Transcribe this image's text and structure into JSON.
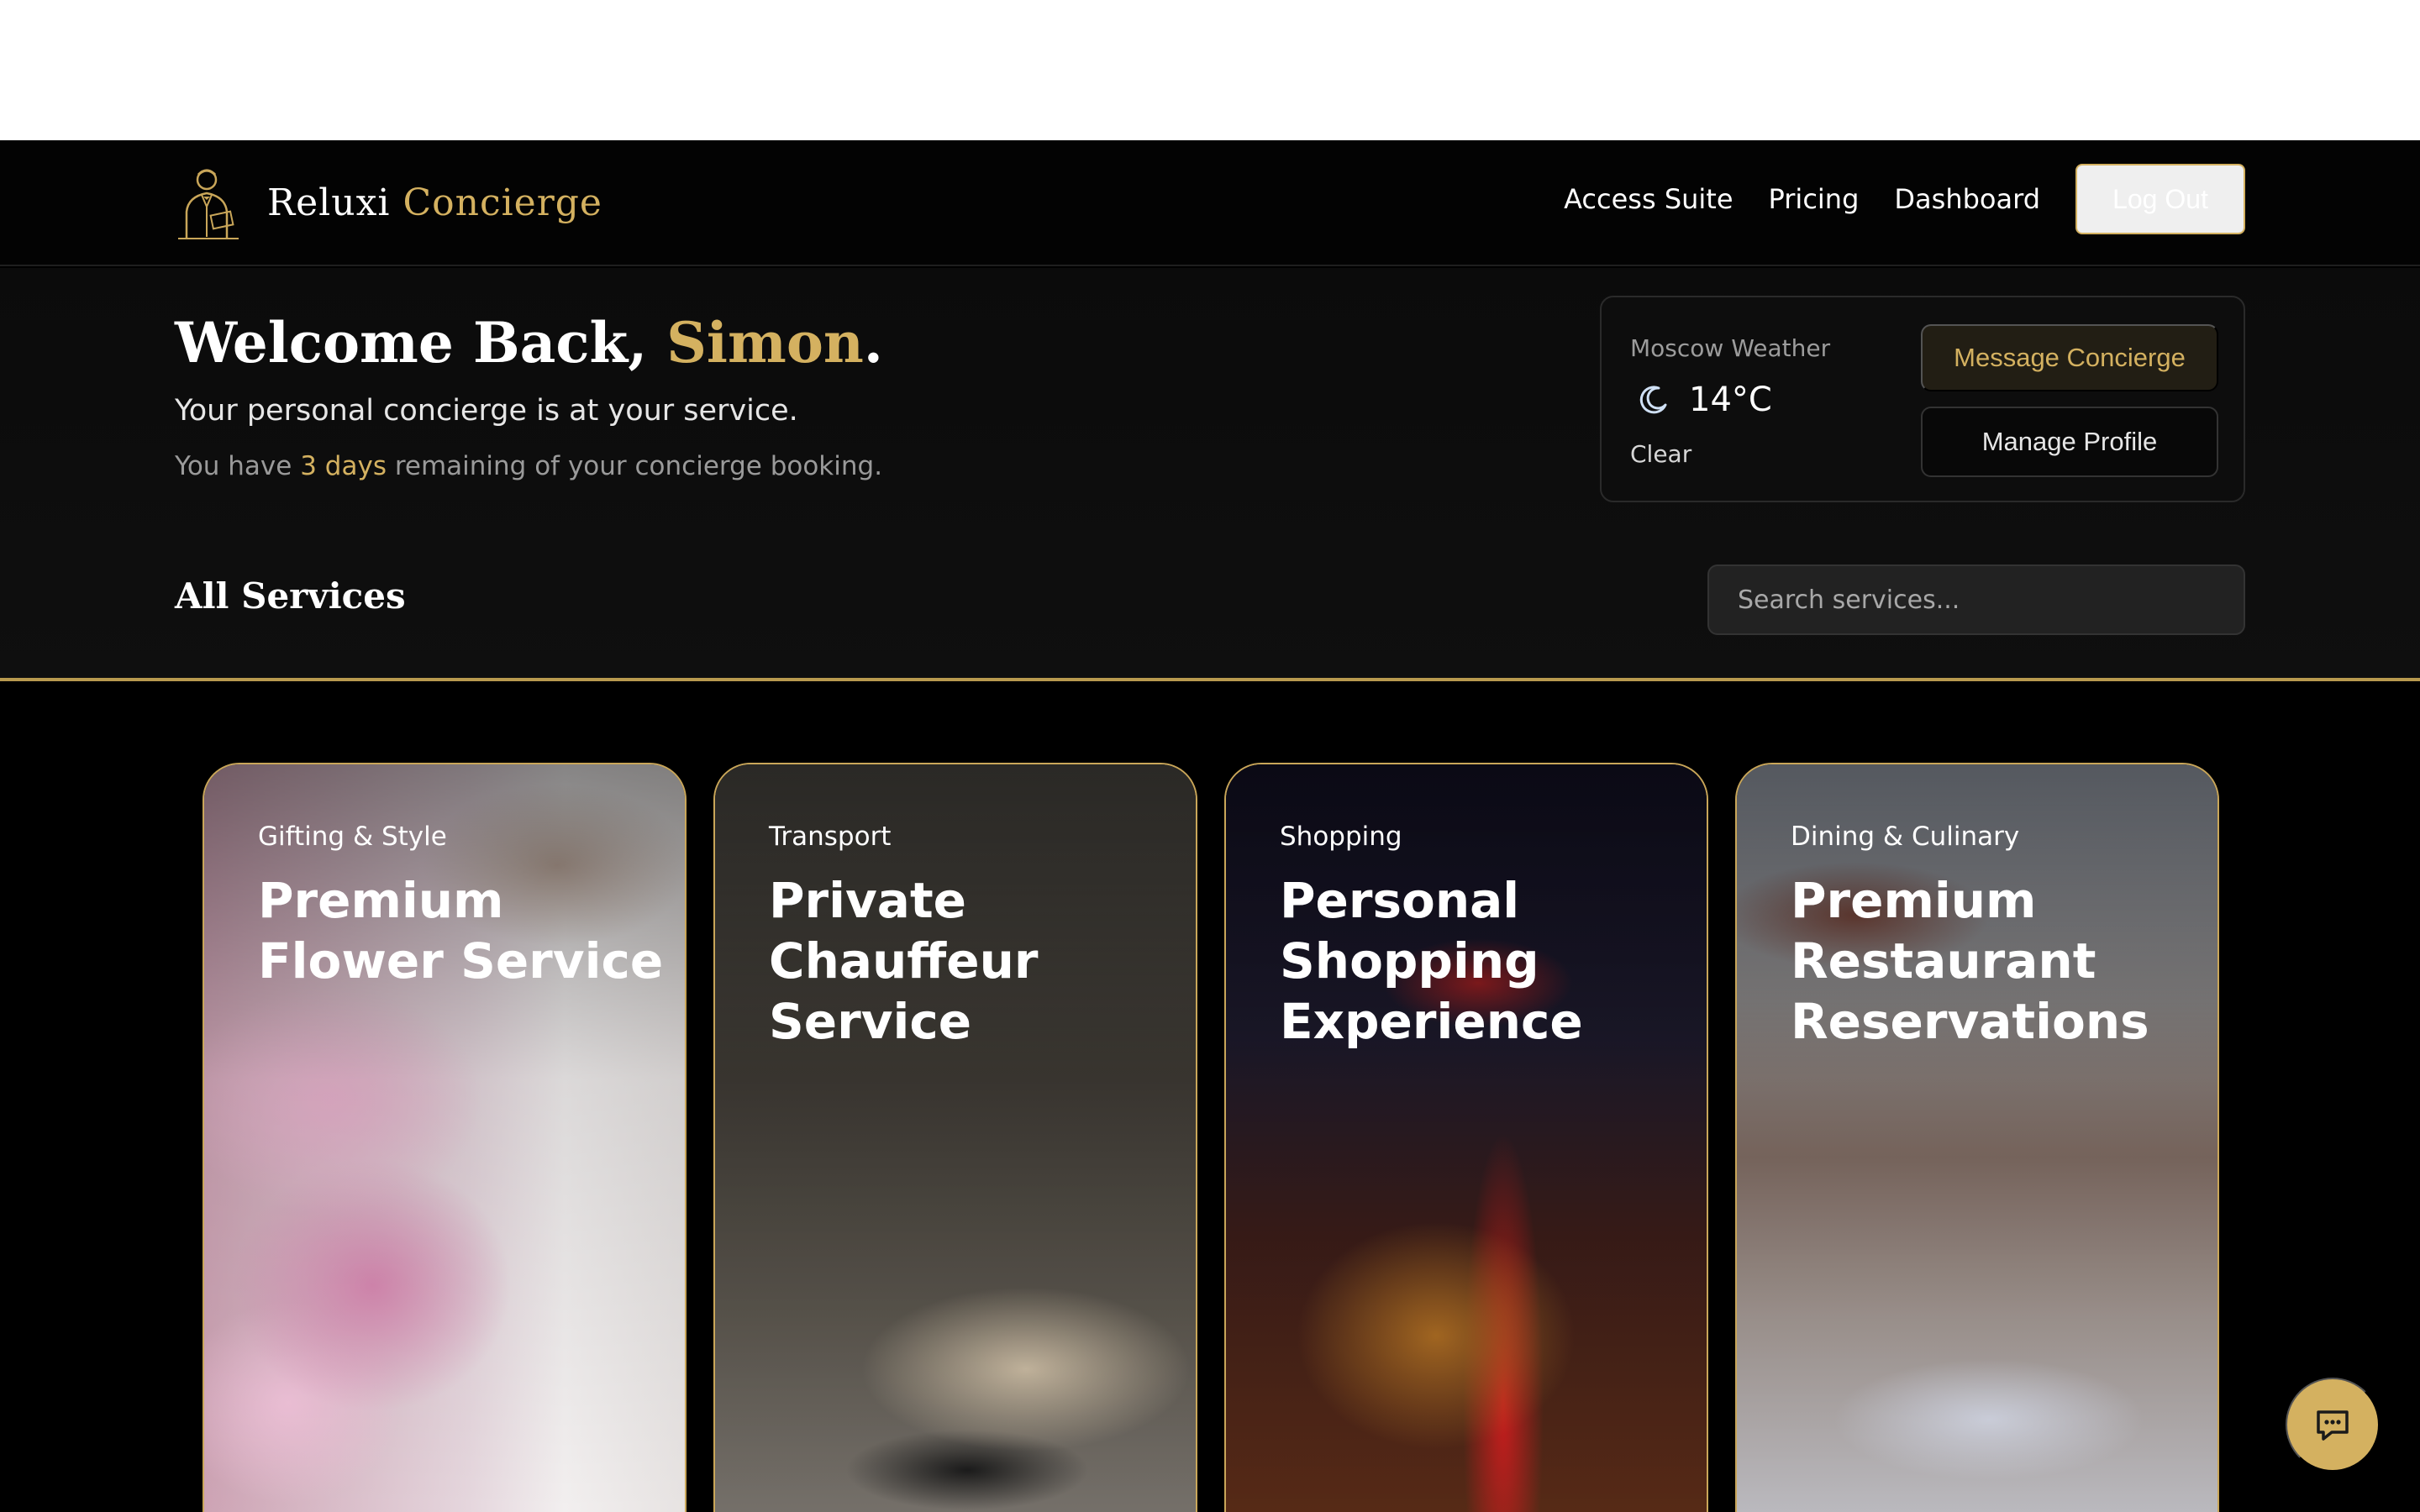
{
  "brand": {
    "name_primary": "Reluxi",
    "name_accent": "Concierge",
    "logo_icon": "concierge-butler-icon"
  },
  "nav": {
    "links": [
      "Access Suite",
      "Pricing",
      "Dashboard"
    ],
    "logout_label": "Log Out"
  },
  "hero": {
    "welcome_prefix": "Welcome Back,",
    "user_name": "Simon",
    "welcome_suffix": ".",
    "subtitle": "Your personal concierge is at your service.",
    "remaining_prefix": "You have",
    "remaining_value": "3 days",
    "remaining_suffix": "remaining of your concierge booking."
  },
  "weather": {
    "label": "Moscow Weather",
    "icon": "moon-icon",
    "temperature": "14°C",
    "condition": "Clear"
  },
  "actions": {
    "message_label": "Message Concierge",
    "profile_label": "Manage Profile"
  },
  "services": {
    "heading": "All Services",
    "search_placeholder": "Search services...",
    "cards": [
      {
        "category": "Gifting & Style",
        "title": "Premium Flower Service"
      },
      {
        "category": "Transport",
        "title": "Private Chauffeur Service"
      },
      {
        "category": "Shopping",
        "title": "Personal Shopping Experience"
      },
      {
        "category": "Dining & Culinary",
        "title": "Premium Restaurant Reservations"
      }
    ]
  },
  "chat": {
    "icon": "chat-bubble-icon"
  },
  "colors": {
    "accent_gold": "#d4b160",
    "background": "#000000",
    "panel": "#0d0d0d"
  }
}
